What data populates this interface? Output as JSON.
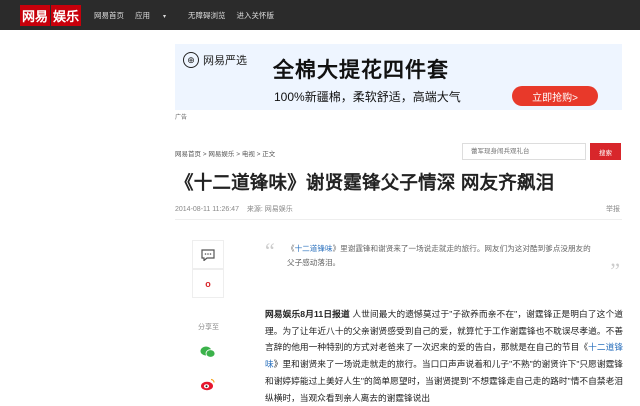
{
  "topbar": {
    "logo_part1": "网易",
    "logo_part2": "娱乐",
    "nav": [
      "网易首页",
      "应用",
      "无障碍浏览",
      "进入关怀版"
    ]
  },
  "ad": {
    "brand": "网易严选",
    "headline": "全棉大提花四件套",
    "subline": "100%新疆棉，柔软舒适，高端大气",
    "cta": "立即抢购>",
    "label": "广告"
  },
  "breadcrumb": "网易首页 > 网易娱乐 > 电视 > 正文",
  "search": {
    "placeholder": "蕾军现身闹兵观礼台",
    "button": "搜索"
  },
  "article": {
    "title": "《十二道锋味》谢贤霆锋父子情深 网友齐飙泪",
    "date": "2014-08-11 11:26:47",
    "source": "来源: 网易娱乐",
    "report": "举报",
    "summary_pre": "《",
    "summary_kw": "十二道锋味",
    "summary_post": "》里谢霆锋和谢贤来了一场说走就走的旅行。网友们为这对酷到爹点没朋友的父子感动落泪。",
    "lead": "网易娱乐8月11日报道",
    "p1": " 人世间最大的遗憾莫过于\"子欲养而亲不在\"，谢霆锋正是明白了这个道理。为了让年近八十的父亲谢贤感受到自己的爱，就算忙于工作谢霆锋也不耽误尽孝道。不善言辞的他用一种特别的方式对老爸来了一次迟来的爱的告白，那就是在自己的节目《",
    "p1_kw": "十二道锋味",
    "p1_post": "》里和谢贤来了一场说走就走的旅行。当口口声声说着和儿子\"不熟\"的谢贤许下\"只愿谢霆锋和谢婷婷能过上美好人生\"的简单愿望时，当谢贤提到\"不想霆锋走自己走的路时\"情不自禁老泪纵横时，当观众看到亲人离去的谢霆锋说出"
  },
  "sidebar": {
    "share_label": "分享至"
  },
  "colors": {
    "brand_red": "#c7000b",
    "search_red": "#d8262b",
    "ad_cta": "#e8392a",
    "keyword_blue": "#2a70bd"
  }
}
